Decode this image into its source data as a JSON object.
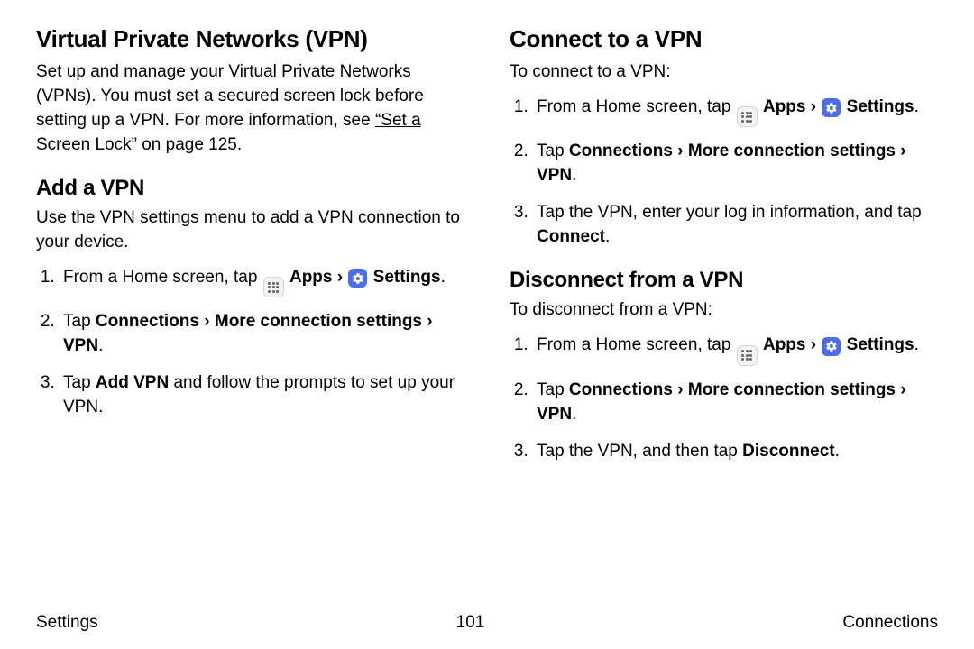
{
  "left": {
    "h1": "Virtual Private Networks (VPN)",
    "intro_pre": "Set up and manage your Virtual Private Networks (VPNs). You must set a secured screen lock before setting up a VPN. For more information, see ",
    "intro_link": "“Set a Screen Lock” on page 125",
    "intro_post": ".",
    "add": {
      "h2": "Add a VPN",
      "p": "Use the VPN settings menu to add a VPN connection to your device.",
      "step1_pre": "From a Home screen, tap ",
      "apps_label": "Apps",
      "settings_label": "Settings",
      "step2_tap": "Tap ",
      "step2_path": "Connections › More connection settings › VPN",
      "step2_post": ".",
      "step3_pre": "Tap ",
      "step3_bold": "Add VPN",
      "step3_post": " and follow the prompts to set up your VPN."
    }
  },
  "right": {
    "connect": {
      "h1": "Connect to a VPN",
      "p": "To connect to a VPN:",
      "step1_pre": "From a Home screen, tap ",
      "apps_label": "Apps",
      "settings_label": "Settings",
      "step2_tap": "Tap ",
      "step2_path": "Connections › More connection settings › VPN",
      "step2_post": ".",
      "step3_pre": "Tap the VPN, enter your log in information, and tap ",
      "step3_bold": "Connect",
      "step3_post": "."
    },
    "disconnect": {
      "h2": "Disconnect from a VPN",
      "p": "To disconnect from a VPN:",
      "step1_pre": "From a Home screen, tap ",
      "apps_label": "Apps",
      "settings_label": "Settings",
      "step2_tap": "Tap ",
      "step2_path": "Connections › More connection settings › VPN",
      "step2_post": ".",
      "step3_pre": "Tap the VPN, and then tap ",
      "step3_bold": "Disconnect",
      "step3_post": "."
    }
  },
  "footer": {
    "left": "Settings",
    "page": "101",
    "right": "Connections"
  },
  "chevron": "›"
}
